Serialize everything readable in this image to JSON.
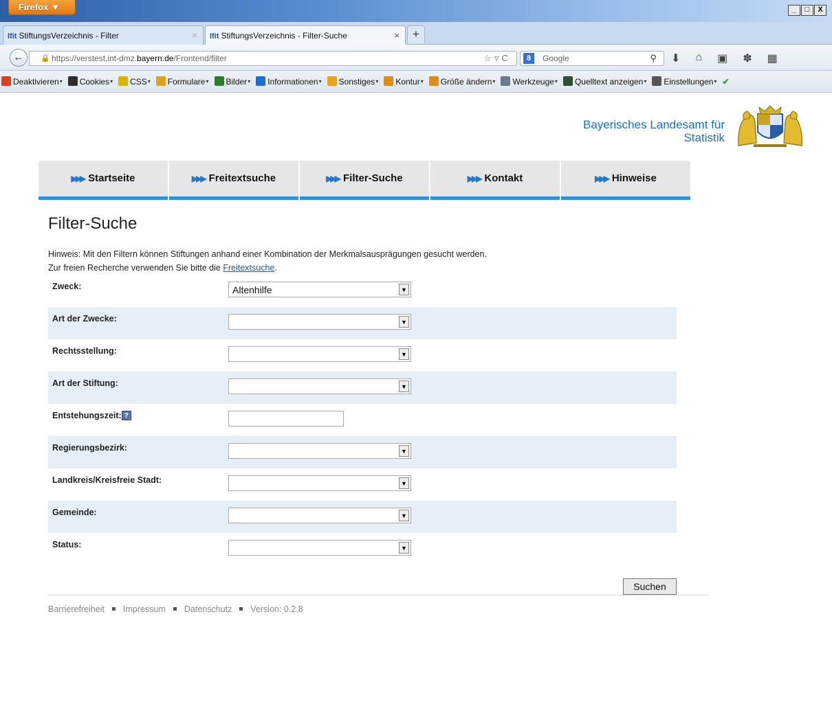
{
  "browser": {
    "menu_button": "Firefox ▼",
    "window_controls": [
      "_",
      "□",
      "X"
    ],
    "tabs": [
      {
        "label": "StiftungsVerzeichnis - Filter",
        "favicon": "lfit"
      },
      {
        "label": "StiftungsVerzeichnis - Filter-Suche",
        "favicon": "lfit"
      }
    ],
    "new_tab": "+",
    "url_prefix": "https://verstest.int-dmz.",
    "url_domain": "bayern.de",
    "url_suffix": "/Frontend/filter",
    "search_placeholder": "Google",
    "search_engine": "8"
  },
  "bookmarks": [
    {
      "label": "Deaktivieren",
      "color": "#d9421c"
    },
    {
      "label": "Cookies",
      "color": "#2e2e2e"
    },
    {
      "label": "CSS",
      "color": "#d8b400"
    },
    {
      "label": "Formulare",
      "color": "#e0a020"
    },
    {
      "label": "Bilder",
      "color": "#2f7a2f"
    },
    {
      "label": "Informationen",
      "color": "#1f6fd1"
    },
    {
      "label": "Sonstiges",
      "color": "#e8a317"
    },
    {
      "label": "Kontur",
      "color": "#e08a1a"
    },
    {
      "label": "Größe ändern",
      "color": "#e08a1a"
    },
    {
      "label": "Werkzeuge",
      "color": "#6a7a8a"
    },
    {
      "label": "Quelltext anzeigen",
      "color": "#2f4f2f"
    },
    {
      "label": "Einstellungen",
      "color": "#555555"
    }
  ],
  "header": {
    "org_line1": "Bayerisches Landesamt für",
    "org_line2": "Statistik"
  },
  "nav": [
    {
      "label": "Startseite"
    },
    {
      "label": "Freitextsuche"
    },
    {
      "label": "Filter-Suche"
    },
    {
      "label": "Kontakt"
    },
    {
      "label": "Hinweise"
    }
  ],
  "nav_arrow": "▶▶▶",
  "main": {
    "title": "Filter-Suche",
    "hint_line1": "Hinweis: Mit den Filtern können Stiftungen anhand einer Kombination der Merkmalsausprägungen gesucht werden.",
    "hint_line2_prefix": "Zur freien Recherche verwenden Sie bitte die ",
    "hint_link": "Freitextsuche",
    "hint_line2_suffix": "."
  },
  "form": {
    "zweck": {
      "label": "Zweck:",
      "value": "Altenhilfe"
    },
    "art_der_zwecke": {
      "label": "Art der Zwecke:",
      "value": ""
    },
    "rechtsstellung": {
      "label": "Rechtsstellung:",
      "value": ""
    },
    "art_der_stiftung": {
      "label": "Art der Stiftung:",
      "value": ""
    },
    "entstehungszeit": {
      "label": "Entstehungszeit:",
      "value": "",
      "help": "?"
    },
    "regierungsbezirk": {
      "label": "Regierungsbezirk:",
      "value": ""
    },
    "landkreis": {
      "label": "Landkreis/Kreisfreie Stadt:",
      "value": ""
    },
    "gemeinde": {
      "label": "Gemeinde:",
      "value": ""
    },
    "status": {
      "label": "Status:",
      "value": ""
    },
    "submit": "Suchen"
  },
  "footer": {
    "links": [
      "Barrierefreiheit",
      "Impressum",
      "Datenschutz"
    ],
    "version": "Version: 0.2.8"
  },
  "colors": {
    "accent": "#2d92d6",
    "link": "#1a55b3",
    "org_text": "#1a6fc9",
    "row_alt": "#e6eef8"
  }
}
